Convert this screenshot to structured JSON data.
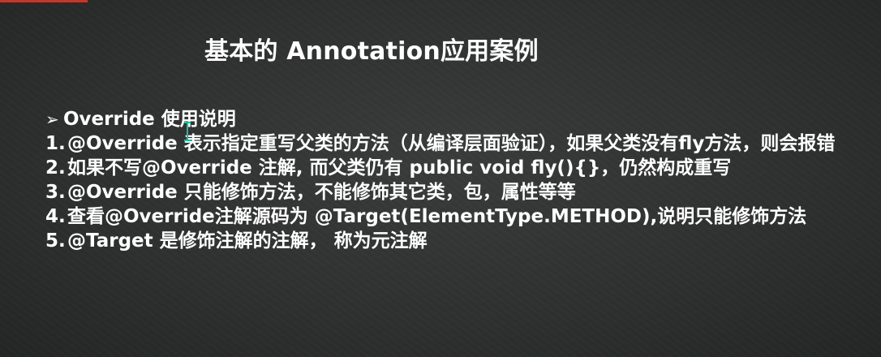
{
  "title": "基本的 Annotation应用案例",
  "section": {
    "bullet": "➢",
    "heading": "Override 使用说明"
  },
  "items": [
    {
      "num": "1.",
      "text": "@Override 表示指定重写父类的方法（从编译层面验证），如果父类没有fly方法，则会报错"
    },
    {
      "num": "2.",
      "text": "如果不写@Override 注解, 而父类仍有 public void fly(){}，仍然构成重写"
    },
    {
      "num": "3.",
      "text": "@Override 只能修饰方法，不能修饰其它类，包，属性等等"
    },
    {
      "num": "4.",
      "text": "查看@Override注解源码为 @Target(ElementType.METHOD),说明只能修饰方法"
    },
    {
      "num": "5.",
      "text": "@Target 是修饰注解的注解， 称为元注解"
    }
  ],
  "colors": {
    "background": "#2e2f2f",
    "text": "#ffffff",
    "accent": "#c0392b",
    "cursor": "#1abc9c"
  },
  "icons": {
    "cursor": "text-cursor-icon"
  }
}
